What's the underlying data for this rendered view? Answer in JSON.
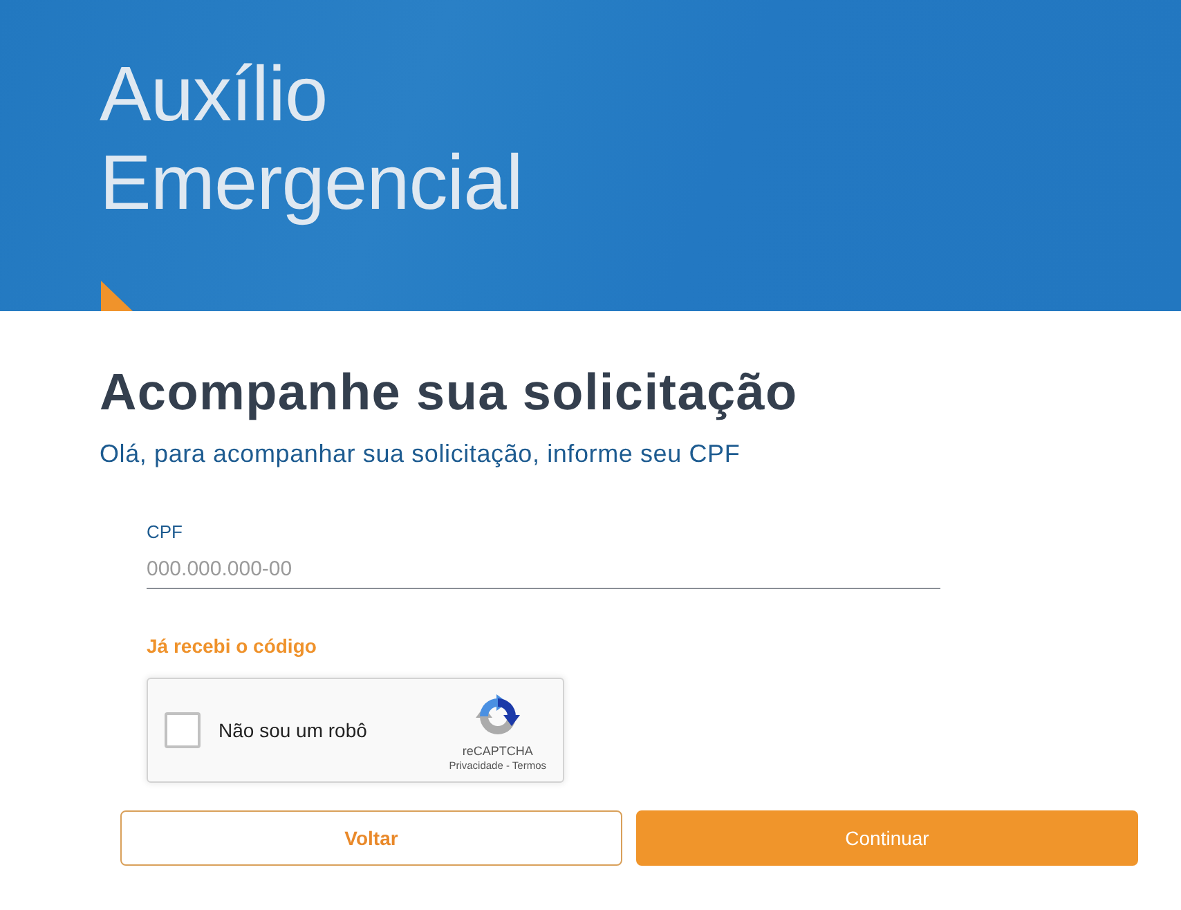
{
  "header": {
    "title": "Auxílio Emergencial"
  },
  "heading": "Acompanhe sua solicitação",
  "subtitle": "Olá, para acompanhar sua solicitação, informe seu CPF",
  "cpf_field": {
    "label": "CPF",
    "placeholder": "000.000.000-00"
  },
  "code_link": "Já recebi o código",
  "captcha": {
    "label": "Não sou um robô",
    "checked": false,
    "brand": "reCAPTCHA",
    "links": "Privacidade - Termos"
  },
  "buttons": [
    {
      "label": "Voltar",
      "kind": "secondary"
    },
    {
      "label": "Continuar",
      "kind": "primary"
    }
  ]
}
